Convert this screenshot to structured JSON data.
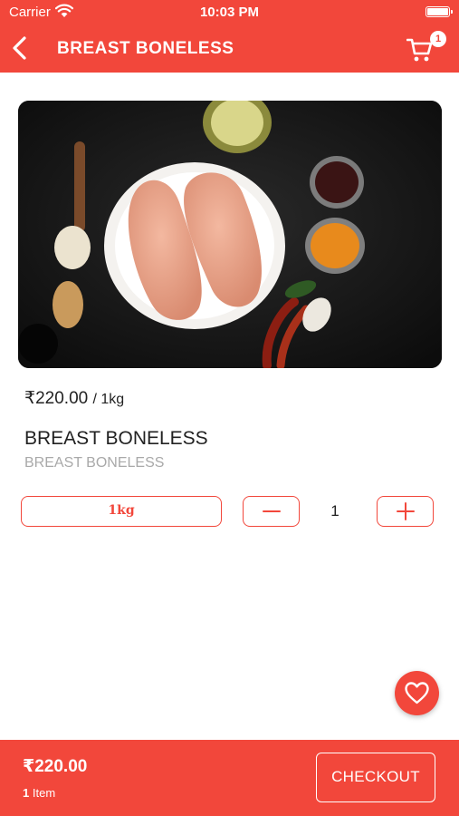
{
  "status_bar": {
    "carrier": "Carrier",
    "time": "10:03 PM"
  },
  "nav": {
    "title": "BREAST BONELESS",
    "cart_count": "1"
  },
  "product": {
    "price": "₹220.00",
    "unit": "/ 1kg",
    "name": "BREAST BONELESS",
    "subtitle": "BREAST BONELESS",
    "weight_option": "1kg",
    "quantity": "1"
  },
  "footer": {
    "total": "₹220.00",
    "item_count": "1",
    "item_label": "Item",
    "checkout_label": "CHECKOUT"
  },
  "colors": {
    "accent": "#f2473b",
    "background": "#ffffff",
    "muted_text": "#a9a9a9"
  },
  "icons": [
    "wifi-icon",
    "battery-icon",
    "back-chevron-icon",
    "cart-icon",
    "minus-icon",
    "plus-icon",
    "heart-icon"
  ]
}
